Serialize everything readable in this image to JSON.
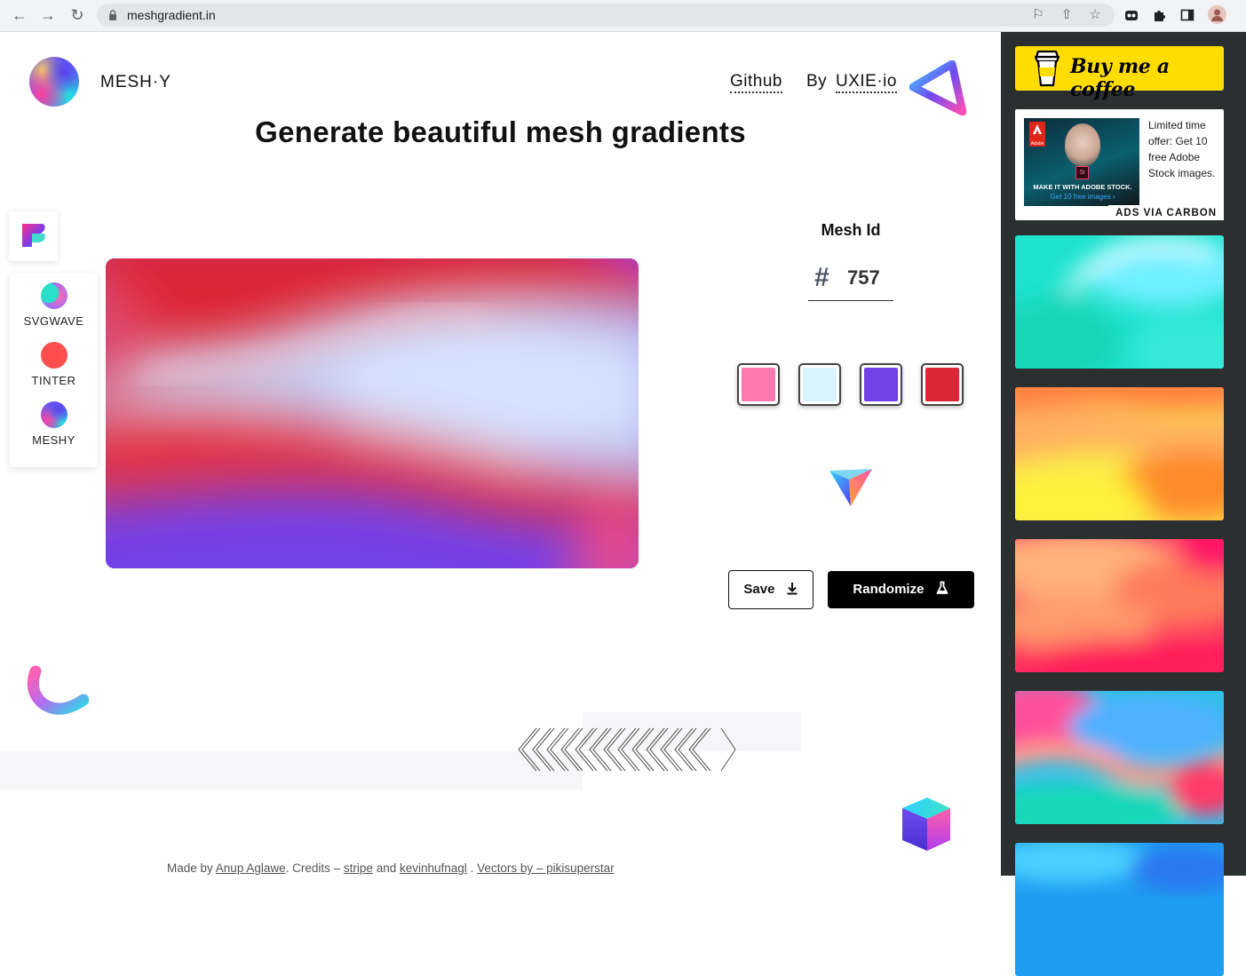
{
  "browser": {
    "url": "meshgradient.in"
  },
  "header": {
    "brand": "MESH·Y",
    "github_label": "Github",
    "by_label": "By",
    "uxie_label": "UXIE·io"
  },
  "main": {
    "title": "Generate beautiful mesh gradients",
    "mesh_id_label": "Mesh Id",
    "mesh_id_hash": "#",
    "mesh_id_value": "757",
    "swatches": [
      "#ff79b0",
      "#d9f3ff",
      "#7440e8",
      "#dd2538"
    ],
    "save_label": "Save",
    "randomize_label": "Randomize"
  },
  "apps": [
    {
      "label": "SVGWAVE",
      "icon": "svgwave-icon"
    },
    {
      "label": "TINTER",
      "icon": "tinter-icon"
    },
    {
      "label": "MESHY",
      "icon": "meshy-icon"
    }
  ],
  "footer": {
    "made_by": "Made by",
    "author": "Anup Aglawe",
    "credits": ". Credits –",
    "stripe": "stripe",
    "and": "and",
    "kevin": "kevinhufnagl",
    "sep": ".",
    "vectors": "Vectors by – pikisuperstar"
  },
  "sidebar": {
    "bmc_label": "Buy me a coffee",
    "ad_text": "Limited time offer: Get 10 free Adobe Stock images.",
    "ad_via": "ADS VIA CARBON",
    "ad_image_line1": "MAKE IT WITH ADOBE STOCK.",
    "ad_image_line2": "Get 10 free images ›",
    "ad_brand": "Adobe",
    "ad_st": "St"
  },
  "colors": {
    "accent": "#000000",
    "sidebar_bg": "#2b2f30",
    "bmc_yellow": "#ffdd00"
  }
}
